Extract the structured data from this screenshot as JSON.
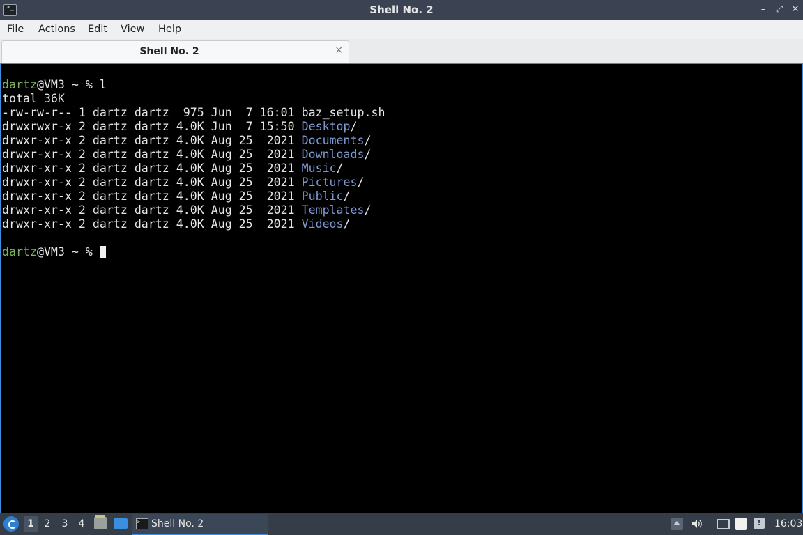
{
  "window": {
    "title": "Shell No. 2",
    "controls": {
      "minimize": "–",
      "restore": "⤢",
      "close": "✕"
    }
  },
  "menu": [
    "File",
    "Actions",
    "Edit",
    "View",
    "Help"
  ],
  "tabs": [
    {
      "label": "Shell No. 2",
      "close": "×"
    }
  ],
  "terminal": {
    "user": "dartz",
    "host_prompt": "@VM3 ~ % ",
    "command": "l",
    "total": "total 36K",
    "entries": [
      {
        "meta": "-rw-rw-r-- 1 dartz dartz  975 Jun  7 16:01 ",
        "name": "baz_setup.sh",
        "suffix": "",
        "is_dir": false
      },
      {
        "meta": "drwxrwxr-x 2 dartz dartz 4.0K Jun  7 15:50 ",
        "name": "Desktop",
        "suffix": "/",
        "is_dir": true
      },
      {
        "meta": "drwxr-xr-x 2 dartz dartz 4.0K Aug 25  2021 ",
        "name": "Documents",
        "suffix": "/",
        "is_dir": true
      },
      {
        "meta": "drwxr-xr-x 2 dartz dartz 4.0K Aug 25  2021 ",
        "name": "Downloads",
        "suffix": "/",
        "is_dir": true
      },
      {
        "meta": "drwxr-xr-x 2 dartz dartz 4.0K Aug 25  2021 ",
        "name": "Music",
        "suffix": "/",
        "is_dir": true
      },
      {
        "meta": "drwxr-xr-x 2 dartz dartz 4.0K Aug 25  2021 ",
        "name": "Pictures",
        "suffix": "/",
        "is_dir": true
      },
      {
        "meta": "drwxr-xr-x 2 dartz dartz 4.0K Aug 25  2021 ",
        "name": "Public",
        "suffix": "/",
        "is_dir": true
      },
      {
        "meta": "drwxr-xr-x 2 dartz dartz 4.0K Aug 25  2021 ",
        "name": "Templates",
        "suffix": "/",
        "is_dir": true
      },
      {
        "meta": "drwxr-xr-x 2 dartz dartz 4.0K Aug 25  2021 ",
        "name": "Videos",
        "suffix": "/",
        "is_dir": true
      }
    ]
  },
  "taskbar": {
    "workspaces": [
      "1",
      "2",
      "3",
      "4"
    ],
    "active_workspace": "1",
    "task_label": "Shell No. 2",
    "info_glyph": "!",
    "clock": "16:03"
  },
  "colors": {
    "prompt_user": "#7db45b",
    "directory": "#7f9bd6",
    "accent": "#3d8ee0"
  }
}
